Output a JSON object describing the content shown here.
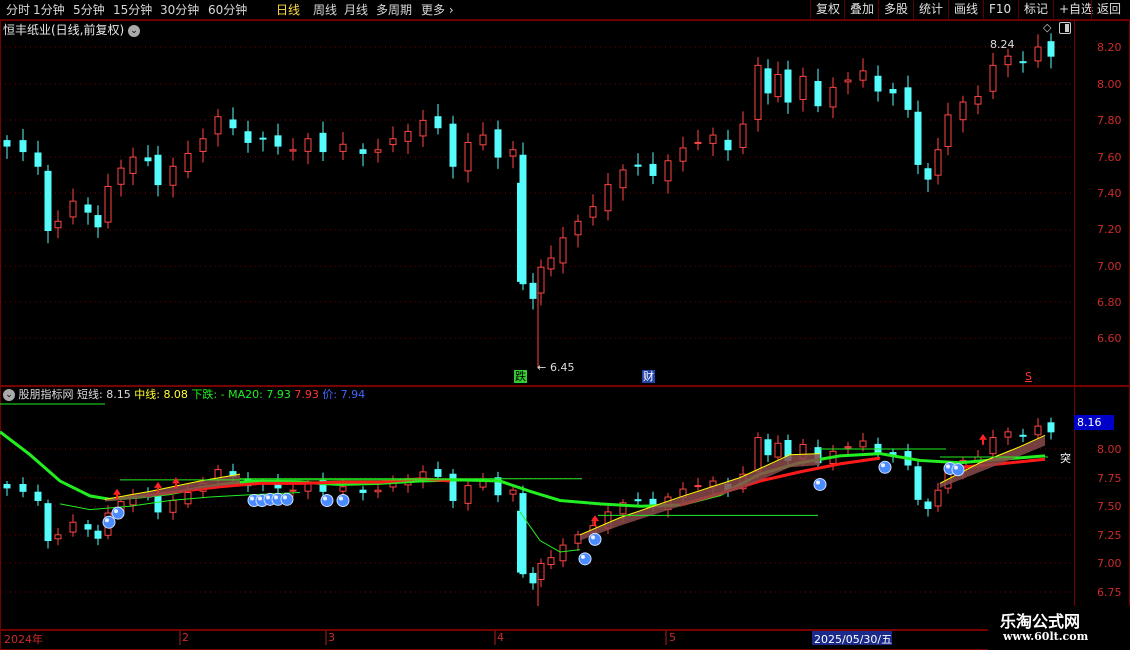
{
  "toolbar": {
    "periods": [
      "分时",
      "1分钟",
      "5分钟",
      "15分钟",
      "30分钟",
      "60分钟",
      "日线",
      "周线",
      "月线",
      "多周期",
      "更多"
    ],
    "active_period": "日线",
    "right_buttons": [
      "复权",
      "叠加",
      "多股",
      "统计",
      "画线",
      "F10",
      "标记",
      "+自选",
      "返回"
    ]
  },
  "main": {
    "title": "恒丰纸业(日线,前复权)",
    "y_ticks": [
      "8.20",
      "8.00",
      "7.80",
      "7.60",
      "7.40",
      "7.20",
      "7.00",
      "6.80",
      "6.60"
    ],
    "high_label": "8.24",
    "low_label": "6.45",
    "marker_die": "跌",
    "marker_cai": "财",
    "marker_s": "S"
  },
  "indicator": {
    "name": "股朋指标网",
    "short_label": "短线:",
    "short_value": "8.15",
    "mid_label": "中线:",
    "mid_value": "8.08",
    "down_label": "下跌:",
    "down_value": "-",
    "ma20_label": "MA20:",
    "ma20_value": "7.93",
    "extra_value": "7.93",
    "price_label": "价:",
    "price_value": "7.94",
    "y_ticks": [
      "8.00",
      "7.75",
      "7.50",
      "7.25",
      "7.00",
      "6.75"
    ],
    "current_price": "8.16",
    "tu_label": "突"
  },
  "xaxis": {
    "labels": [
      "2024年",
      "2",
      "3",
      "4",
      "5"
    ],
    "cursor_date": "2025/05/30/五"
  },
  "watermark": {
    "name": "乐淘公式网",
    "url": "www.60lt.com"
  },
  "colors": {
    "up": "#ff4444",
    "down": "#54fcfc",
    "grid": "#7a0000",
    "axis_text": "#cc2b2b",
    "short_line": "#e8e8e8",
    "mid_line": "#ffff00",
    "ma20_green": "#22ee22",
    "trend_red": "#ff1a1a"
  },
  "icons": [
    "circle-chevron-icon",
    "diamond-icon",
    "square-icon",
    "arrow-up-icon",
    "blue-ball-icon"
  ]
}
